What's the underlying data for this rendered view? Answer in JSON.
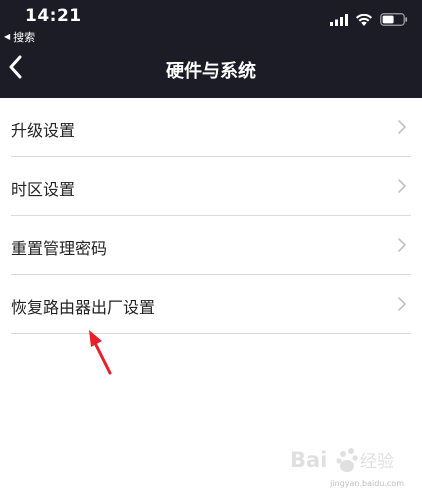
{
  "status_bar": {
    "time": "14:21",
    "back_to_app": "搜索",
    "icons": [
      "signal-icon",
      "wifi-icon",
      "battery-icon"
    ]
  },
  "nav": {
    "title": "硬件与系统",
    "back_icon": "chevron-left-icon"
  },
  "settings": {
    "items": [
      {
        "label": "升级设置"
      },
      {
        "label": "时区设置"
      },
      {
        "label": "重置管理密码"
      },
      {
        "label": "恢复路由器出厂设置"
      }
    ]
  },
  "colors": {
    "header_bg": "#1b1c25",
    "header_text": "#ffffff",
    "list_text": "#222222",
    "divider": "#dadada",
    "chevron": "#c2c2c2",
    "annotation": "#e8202a"
  },
  "watermark": {
    "text": "Baidu 经验",
    "subtext": "jingyan.baidu.com"
  }
}
